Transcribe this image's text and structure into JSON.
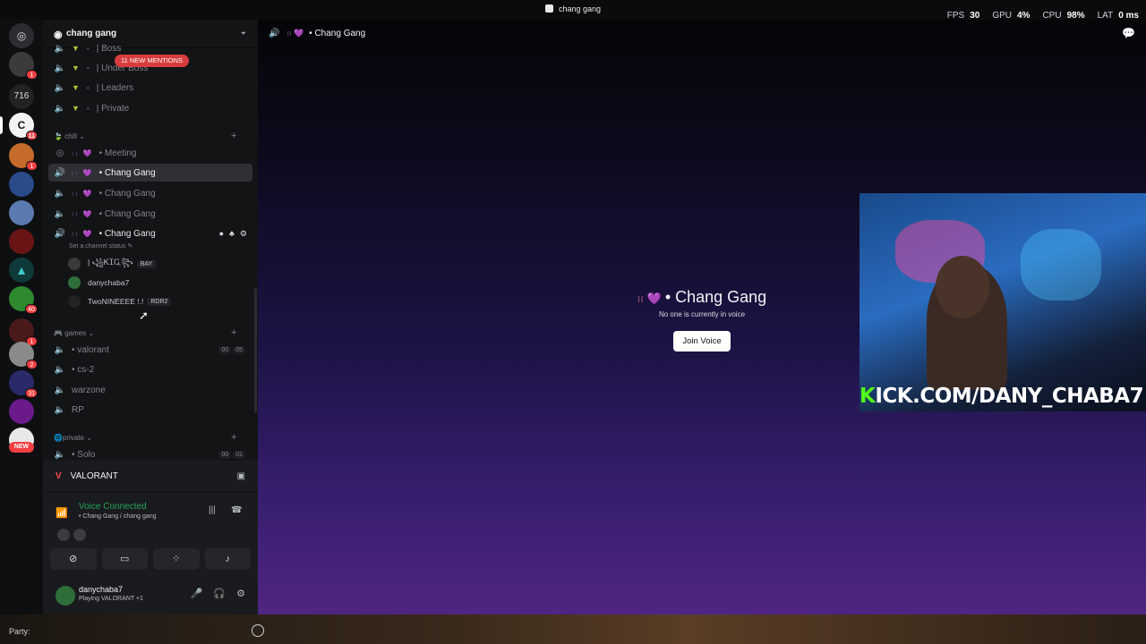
{
  "window": {
    "title": "chang gang"
  },
  "perf": [
    {
      "label": "FPS",
      "value": "30"
    },
    {
      "label": "GPU",
      "value": "4%"
    },
    {
      "label": "CPU",
      "value": "98%"
    },
    {
      "label": "LAT",
      "value": "0 ms"
    }
  ],
  "servers": [
    {
      "badge": ""
    },
    {
      "badge": "1"
    },
    {
      "badge": ""
    },
    {
      "badge": "11"
    },
    {
      "badge": "1"
    },
    {
      "badge": ""
    },
    {
      "badge": ""
    },
    {
      "badge": ""
    },
    {
      "badge": ""
    },
    {
      "badge": "40"
    },
    {
      "badge": "1"
    },
    {
      "badge": "2"
    },
    {
      "badge": "31"
    },
    {
      "badge": ""
    },
    {
      "badge": ""
    }
  ],
  "server_new_label": "NEW",
  "server": {
    "name": "chang gang"
  },
  "mentions_label": "11 NEW MENTIONS",
  "channels_top": [
    {
      "name": "| Boss"
    },
    {
      "name": "| Under Boss"
    },
    {
      "name": "| Leaders"
    },
    {
      "name": "| Private"
    }
  ],
  "categories": {
    "chill": "chill",
    "games": "games",
    "private": "private"
  },
  "chill_channels": [
    {
      "name": "• Meeting"
    },
    {
      "name": "• Chang Gang"
    },
    {
      "name": "• Chang Gang"
    },
    {
      "name": "• Chang Gang"
    },
    {
      "name": "• Chang Gang"
    }
  ],
  "status_hint": "Set a channel status",
  "voice_users": [
    {
      "name": "| ꧁ᏦᏆᏩ꧂",
      "tag": "BAY"
    },
    {
      "name": "danychaba7",
      "tag": ""
    },
    {
      "name": "TwoNINEEEE !.!",
      "tag": "RDR2"
    }
  ],
  "game_channels": [
    {
      "name": "• valorant",
      "limits": [
        "00",
        "05"
      ]
    },
    {
      "name": "• cs-2",
      "limits": []
    },
    {
      "name": "warzone",
      "limits": []
    },
    {
      "name": "RP",
      "limits": []
    }
  ],
  "private_channels": [
    {
      "name": "• Solo",
      "limits": [
        "00",
        "01"
      ]
    }
  ],
  "panel": {
    "game": "VALORANT",
    "voice_status": "Voice Connected",
    "voice_path": "• Chang Gang / chang gang",
    "username": "danychaba7",
    "activity": "Playing VALORANT +1"
  },
  "main": {
    "channel": "• Chang Gang",
    "empty_text": "No one is currently in voice",
    "join_label": "Join Voice"
  },
  "overlay": {
    "kick_k": "K",
    "kick_rest": "ICK.COM/DANY_CHABA7"
  },
  "footer": {
    "party_label": "Party:"
  },
  "colors": {
    "accent_green": "#23a55a",
    "mention_red": "#d83c3e",
    "kick_green": "#53fc18"
  }
}
